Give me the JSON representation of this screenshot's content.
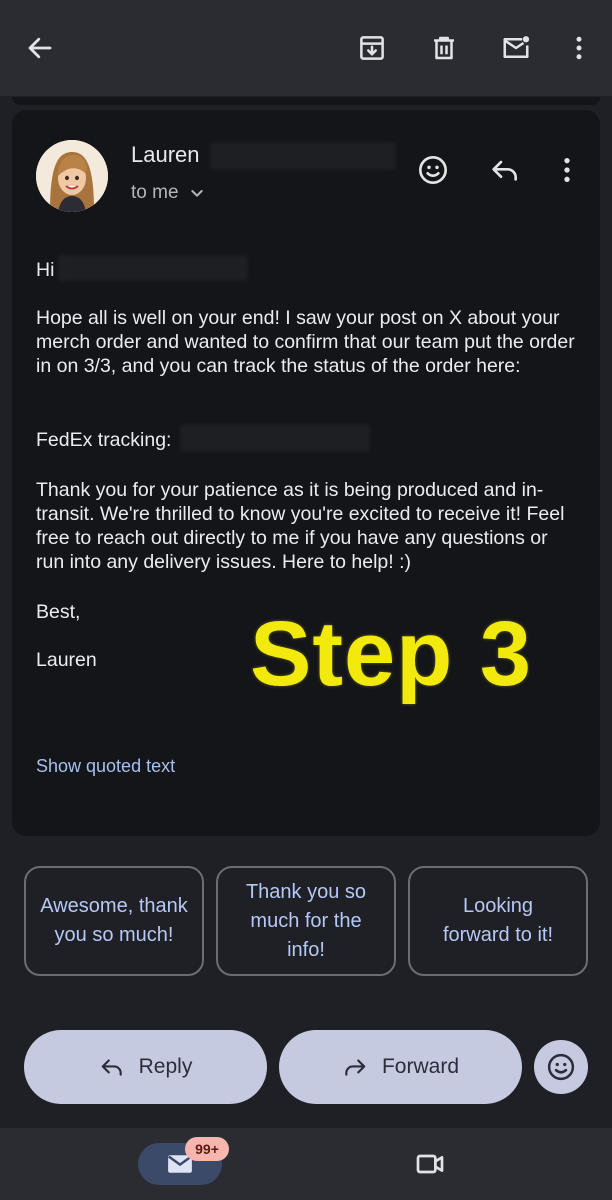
{
  "toolbar": {
    "icons": [
      "back-arrow-icon",
      "archive-icon",
      "delete-icon",
      "mark-unread-icon",
      "more-vert-icon"
    ]
  },
  "email": {
    "sender_name": "Lauren",
    "recipient_label": "to me",
    "greeting": "Hi",
    "paragraph1": "Hope all is well on your end! I saw your post on X about your merch order and wanted to confirm that our team put the order in on 3/3, and you can track the status of the order here:",
    "tracking_label": "FedEx tracking:",
    "paragraph2": "Thank you for your patience as it is being produced and in-transit. We're thrilled to know you're excited to receive it! Feel free to reach out directly to me if you have any questions or run into any delivery issues. Here to help! :)",
    "signoff": "Best,",
    "signature": "Lauren",
    "show_quoted": "Show quoted text",
    "overlay_label": "Step 3"
  },
  "smart_replies": [
    "Awesome, thank you so much!",
    "Thank you so much for the info!",
    "Looking forward to it!"
  ],
  "actions": {
    "reply": "Reply",
    "forward": "Forward"
  },
  "bottom_nav": {
    "mail_badge": "99+"
  },
  "colors": {
    "background": "#1f2025",
    "card": "#141519",
    "accent_link": "#a5c1f2",
    "pill": "#c5cae0",
    "step_overlay": "#f2ea0c"
  }
}
